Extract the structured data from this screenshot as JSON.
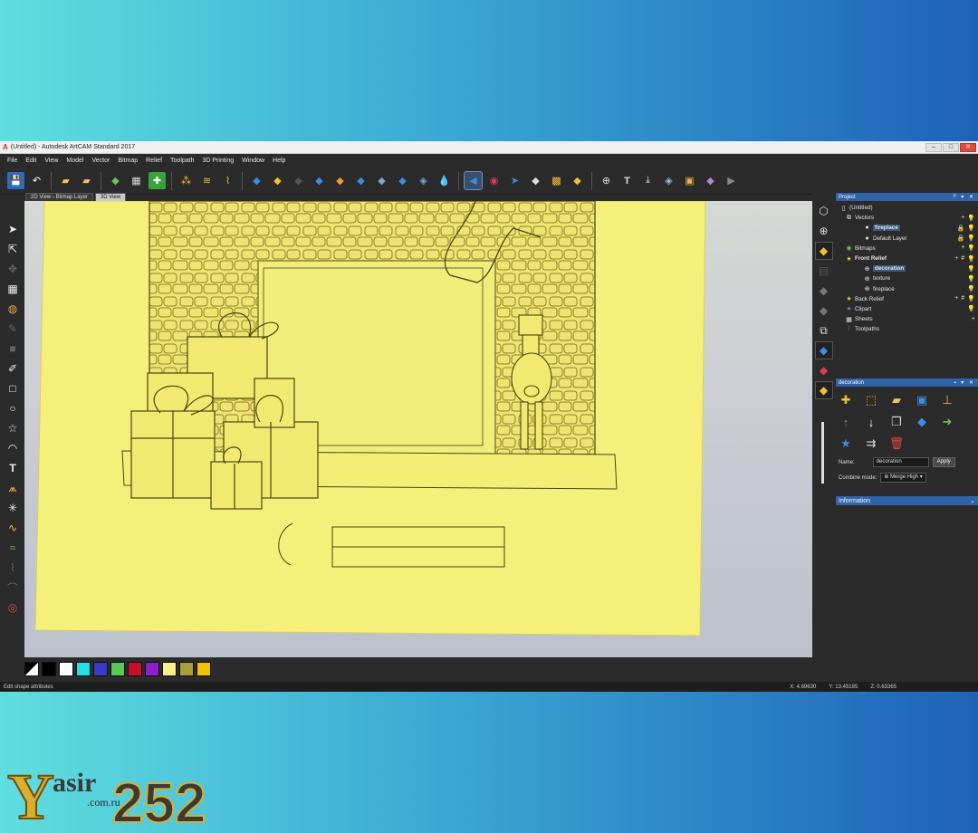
{
  "window": {
    "title": "(Untitled) - Autodesk ArtCAM Standard 2017",
    "app_icon": "artcam-logo-icon"
  },
  "menu": [
    "File",
    "Edit",
    "View",
    "Model",
    "Vector",
    "Bitmap",
    "Relief",
    "Toolpath",
    "3D Printing",
    "Window",
    "Help"
  ],
  "view_tabs": [
    "2D View - Bitmap Layer",
    "3D View"
  ],
  "active_tab": "3D View",
  "project": {
    "title": "Project",
    "buttons": "? ▾ ✕",
    "tree": [
      {
        "label": "(Untitled)",
        "icon": "document-icon"
      },
      {
        "label": "Vectors",
        "icon": "vectors-icon"
      },
      {
        "label": "fireplace",
        "icon": "layer-dot-icon"
      },
      {
        "label": "Default Layer",
        "icon": "layer-dot-icon"
      },
      {
        "label": "Bitmaps",
        "icon": "bitmaps-icon"
      },
      {
        "label": "Front Relief",
        "icon": "star-icon"
      },
      {
        "label": "decoration",
        "icon": "relief-layer-icon"
      },
      {
        "label": "texture",
        "icon": "relief-layer-icon"
      },
      {
        "label": "fireplace",
        "icon": "relief-layer-icon"
      },
      {
        "label": "Back Relief",
        "icon": "star-icon"
      },
      {
        "label": "Clipart",
        "icon": "clipart-icon"
      },
      {
        "label": "Sheets",
        "icon": "sheets-icon"
      },
      {
        "label": "Toolpaths",
        "icon": "toolpaths-icon"
      }
    ]
  },
  "decoration_panel": {
    "title": "decoration",
    "name_label": "Name:",
    "name_value": "decoration",
    "apply_label": "Apply",
    "combine_label": "Combine mode:",
    "combine_value": "Merge High"
  },
  "information_label": "Information",
  "status": {
    "message": "Edit shape attributes",
    "x": "X: 4.69630",
    "y": "Y: 13.45185",
    "z": "Z: 0.63365"
  },
  "palette": [
    "#000000",
    "#ffffff",
    "#22e0e6",
    "#3a3ac8",
    "#5cc85c",
    "#c8102e",
    "#8b1fc8",
    "#f8f08c",
    "#a8a03c",
    "#f2c200"
  ],
  "relief_color": "#f4f07a",
  "logo": {
    "letter": "Y",
    "word": "asir",
    "number": "252",
    "domain": ".com.ru"
  }
}
